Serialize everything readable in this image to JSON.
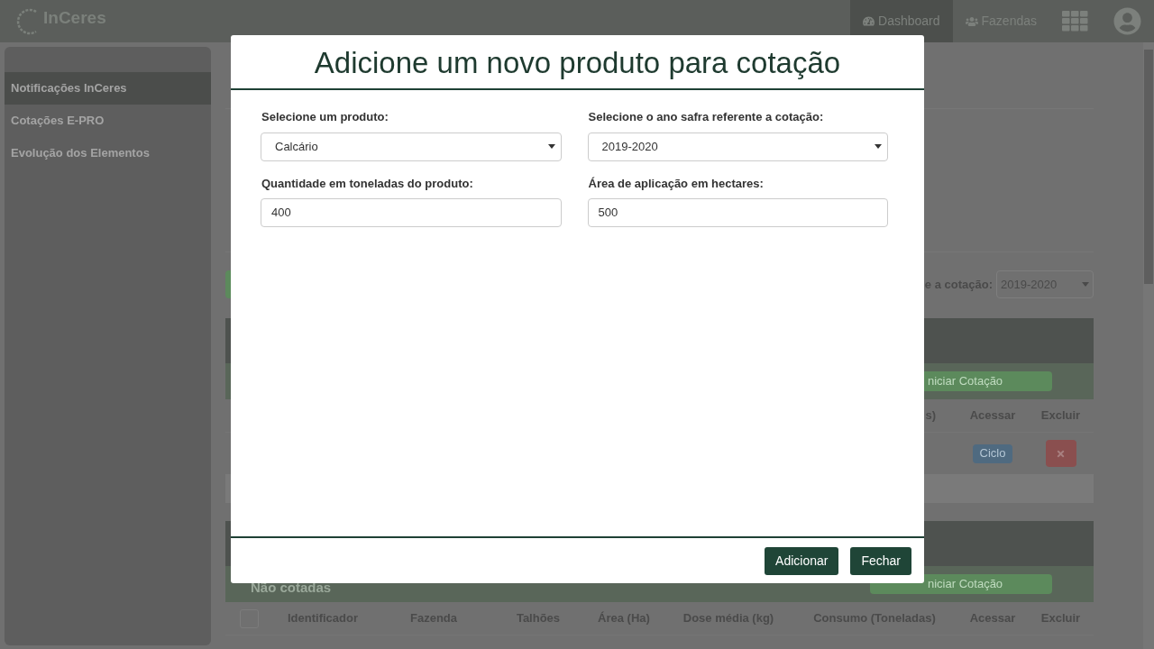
{
  "header": {
    "logo": "InCeres",
    "nav": [
      {
        "label": "Dashboard",
        "selected": true
      },
      {
        "label": "Fazendas",
        "selected": false
      }
    ]
  },
  "sidebar": {
    "items": [
      {
        "label": "Notificações InCeres",
        "selected": true
      },
      {
        "label": "Cotações E-PRO",
        "selected": false
      },
      {
        "label": "Evolução dos Elementos",
        "selected": false
      }
    ]
  },
  "main": {
    "safra_label": "e a cotação:",
    "safra_value": "2019-2020",
    "panels": [
      {
        "start_button": "niciar Cotação",
        "columns": [
          "s)",
          "Acessar",
          "Excluir"
        ],
        "rows": [
          {
            "access": "Ciclo"
          }
        ]
      },
      {
        "title": "Não cotadas",
        "start_button": "niciar Cotação",
        "select_all": {
          "checked": false
        },
        "columns": [
          "Identificador",
          "Fazenda",
          "Talhões",
          "Área (Ha)",
          "Dose média (kg)",
          "Consumo (Toneladas)",
          "Acessar",
          "Excluir"
        ]
      }
    ]
  },
  "modal": {
    "title": "Adicione um novo produto para cotação",
    "fields": [
      {
        "label": "Selecione um produto:",
        "kind": "select",
        "value": "Calcário"
      },
      {
        "label": "Selecione o ano safra referente a cotação:",
        "kind": "select",
        "value": "2019-2020"
      },
      {
        "label": "Quantidade em toneladas do produto:",
        "kind": "input",
        "value": "400"
      },
      {
        "label": "Área de aplicação em hectares:",
        "kind": "input",
        "value": "500"
      }
    ],
    "buttons": [
      "Adicionar",
      "Fechar"
    ]
  }
}
